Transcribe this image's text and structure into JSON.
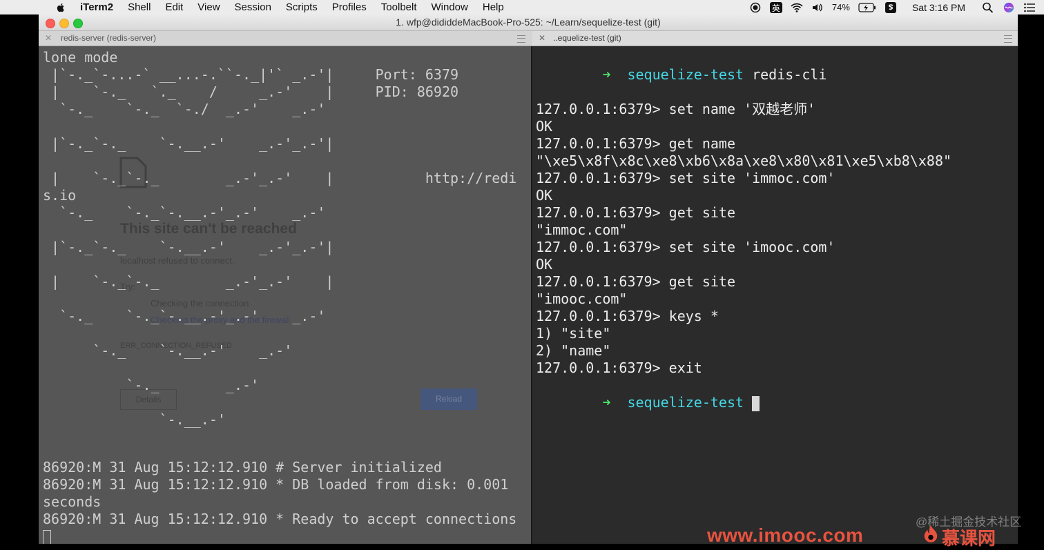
{
  "menubar": {
    "app": "iTerm2",
    "items": [
      "Shell",
      "Edit",
      "View",
      "Session",
      "Scripts",
      "Profiles",
      "Toolbelt",
      "Window",
      "Help"
    ],
    "ime": "英",
    "battery": "74%",
    "clock": "Sat 3:16 PM"
  },
  "window": {
    "title": "1. wfp@dididdeMacBook-Pro-525: ~/Learn/sequelize-test (git)",
    "tabs": [
      {
        "label": "redis-server (redis-server)"
      },
      {
        "label": "..equelize-test (git)"
      }
    ]
  },
  "left_pane": {
    "top_line": "lone mode",
    "ascii_art": [
      " |`-._`-...-` __...-.``-._|'` _.-'|     Port: 6379",
      " |    `-._   `._    /     _.-'    |     PID: 86920",
      "  `-._    `-._  `-./  _.-'    _.-'",
      "",
      " |`-._`-._    `-.__.-'    _.-'_.-'|",
      "",
      " |    `-._`-._        _.-'_.-'    |           http://redi",
      "s.io",
      "  `-._    `-._`-.__.-'_.-'    _.-'",
      "",
      " |`-._`-._    `-.__.-'    _.-'_.-'|",
      "",
      " |    `-._`-._        _.-'_.-'    |",
      "",
      "  `-._    `-._`-.__.-'_.-'    _.-'",
      "",
      "      `-._    `-.__.-'    _.-'",
      "",
      "          `-._        _.-'",
      "",
      "              `-.__.-'"
    ],
    "log": [
      "86920:M 31 Aug 15:12:12.910 # Server initialized",
      "86920:M 31 Aug 15:12:12.910 * DB loaded from disk: 0.001",
      "seconds",
      "86920:M 31 Aug 15:12:12.910 * Ready to accept connections"
    ]
  },
  "right_pane": {
    "prompt_arrow": "➜",
    "prompt_dir": "sequelize-test",
    "first_command": "redis-cli",
    "session": [
      "127.0.0.1:6379> set name '双越老师'",
      "OK",
      "127.0.0.1:6379> get name",
      "\"\\xe5\\x8f\\x8c\\xe8\\xb6\\x8a\\xe8\\x80\\x81\\xe5\\xb8\\x88\"",
      "127.0.0.1:6379> set site 'immoc.com'",
      "OK",
      "127.0.0.1:6379> get site",
      "\"immoc.com\"",
      "127.0.0.1:6379> set site 'imooc.com'",
      "OK",
      "127.0.0.1:6379> get site",
      "\"imooc.com\"",
      "127.0.0.1:6379> keys *",
      "1) \"site\"",
      "2) \"name\"",
      "127.0.0.1:6379> exit"
    ]
  },
  "ghost_page": {
    "heading": "This site can't be reached",
    "subtext": "localhost refused to connect.",
    "try_label": "Try:",
    "bullets": [
      "Checking the connection",
      "Checking the proxy and the firewall"
    ],
    "error_code": "ERR_CONNECTION_REFUSED",
    "details_button": "Details",
    "reload_button": "Reload"
  },
  "watermarks": {
    "juejin": "@稀土掘金技术社区",
    "imooc_url": "www.imooc.com",
    "imooc_brand": "慕课网"
  },
  "colors": {
    "arrow": "#4fe36b",
    "dir": "#45d9e6",
    "imooc": "#e8533f"
  }
}
